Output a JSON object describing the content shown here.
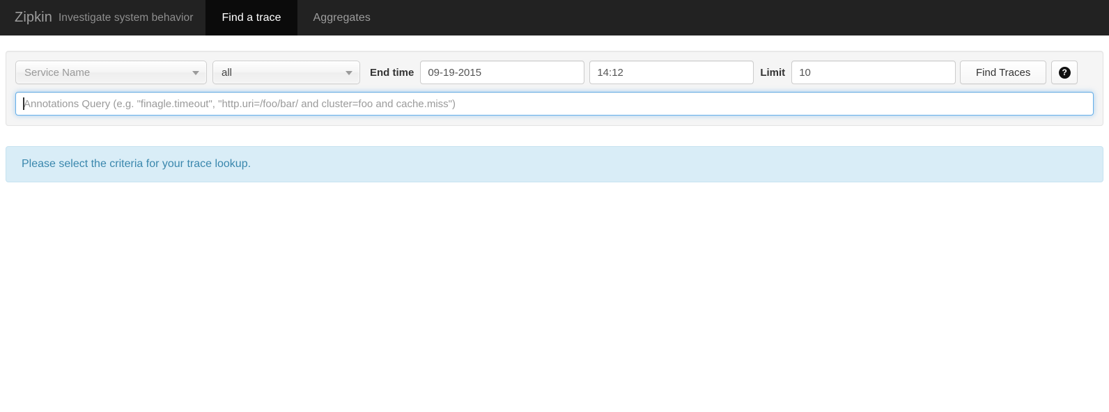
{
  "navbar": {
    "brand": "Zipkin",
    "tagline": "Investigate system behavior",
    "tabs": [
      {
        "label": "Find a trace",
        "active": true
      },
      {
        "label": "Aggregates",
        "active": false
      }
    ]
  },
  "search_form": {
    "service_select": {
      "value": "Service Name",
      "is_placeholder": true,
      "caret_icon": "chevron-down-icon"
    },
    "span_select": {
      "value": "all",
      "is_placeholder": false,
      "caret_icon": "chevron-down-icon"
    },
    "end_time_label": "End time",
    "date_value": "09-19-2015",
    "time_value": "14:12",
    "limit_label": "Limit",
    "limit_value": "10",
    "find_traces_label": "Find Traces",
    "help_button": {
      "icon": "question-circle-icon",
      "glyph": "?"
    },
    "annotations_query": {
      "value": "",
      "placeholder": "Annotations Query (e.g. \"finagle.timeout\", \"http.uri=/foo/bar/ and cluster=foo and cache.miss\")",
      "focused": true
    }
  },
  "alert": {
    "message": "Please select the criteria for your trace lookup."
  },
  "colors": {
    "navbar_bg": "#222222",
    "navbar_active_tab_bg": "#0b0b0b",
    "navbar_text": "#9d9d9d",
    "panel_bg": "#f5f5f5",
    "focus_ring": "#66afe9",
    "alert_bg": "#d9edf7",
    "alert_text": "#3a87ad"
  }
}
